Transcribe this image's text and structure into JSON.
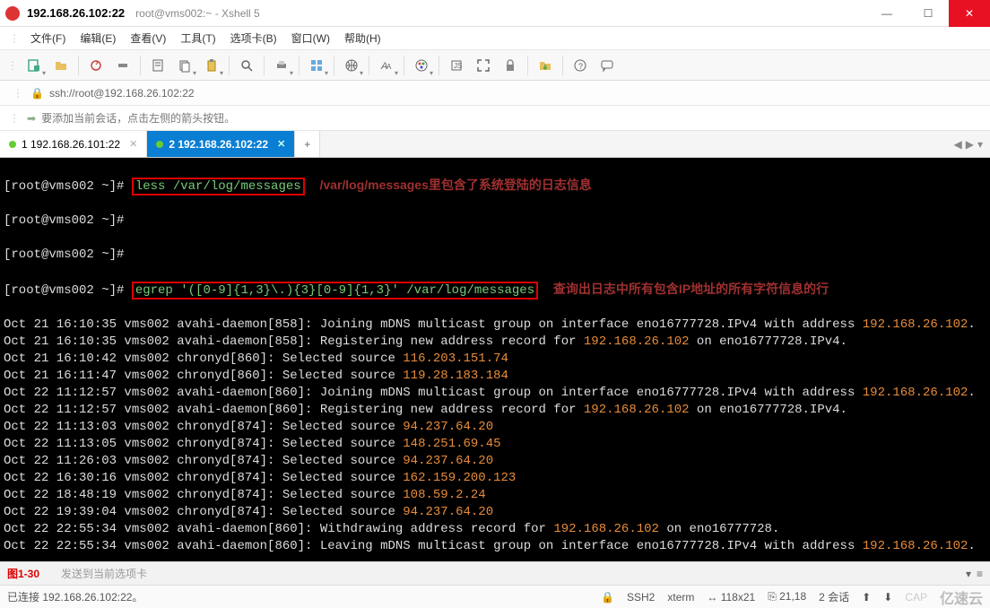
{
  "window": {
    "title_main": "192.168.26.102:22",
    "title_sub": "root@vms002:~ - Xshell 5"
  },
  "menu": {
    "file": "文件(F)",
    "edit": "编辑(E)",
    "view": "查看(V)",
    "tools": "工具(T)",
    "tabs": "选项卡(B)",
    "window": "窗口(W)",
    "help": "帮助(H)"
  },
  "address": {
    "url": "ssh://root@192.168.26.102:22"
  },
  "hint": {
    "text": "要添加当前会话，点击左侧的箭头按钮。"
  },
  "tabs": {
    "items": [
      {
        "label": "1 192.168.26.101:22",
        "active": false
      },
      {
        "label": "2 192.168.26.102:22",
        "active": true
      }
    ]
  },
  "terminal": {
    "prompt": "[root@vms002 ~]#",
    "cmd1": "less /var/log/messages",
    "note1": "/var/log/messages里包含了系统登陆的日志信息",
    "cmd2": "egrep '([0-9]{1,3}\\.){3}[0-9]{1,3}' /var/log/messages",
    "note2": "查询出日志中所有包含IP地址的所有字符信息的行",
    "lines": [
      {
        "pre": "Oct 21 16:10:35 vms002 avahi-daemon[858]: Joining mDNS multicast group on interface eno16777728.IPv4 with address ",
        "ip": "192.168.26.102",
        "post": "."
      },
      {
        "pre": "Oct 21 16:10:35 vms002 avahi-daemon[858]: Registering new address record for ",
        "ip": "192.168.26.102",
        "post": " on eno16777728.IPv4."
      },
      {
        "pre": "Oct 21 16:10:42 vms002 chronyd[860]: Selected source ",
        "ip": "116.203.151.74",
        "post": ""
      },
      {
        "pre": "Oct 21 16:11:47 vms002 chronyd[860]: Selected source ",
        "ip": "119.28.183.184",
        "post": ""
      },
      {
        "pre": "Oct 22 11:12:57 vms002 avahi-daemon[860]: Joining mDNS multicast group on interface eno16777728.IPv4 with address ",
        "ip": "192.168.26.102",
        "post": "."
      },
      {
        "pre": "Oct 22 11:12:57 vms002 avahi-daemon[860]: Registering new address record for ",
        "ip": "192.168.26.102",
        "post": " on eno16777728.IPv4."
      },
      {
        "pre": "Oct 22 11:13:03 vms002 chronyd[874]: Selected source ",
        "ip": "94.237.64.20",
        "post": ""
      },
      {
        "pre": "Oct 22 11:13:05 vms002 chronyd[874]: Selected source ",
        "ip": "148.251.69.45",
        "post": ""
      },
      {
        "pre": "Oct 22 11:26:03 vms002 chronyd[874]: Selected source ",
        "ip": "94.237.64.20",
        "post": ""
      },
      {
        "pre": "Oct 22 16:30:16 vms002 chronyd[874]: Selected source ",
        "ip": "162.159.200.123",
        "post": ""
      },
      {
        "pre": "Oct 22 18:48:19 vms002 chronyd[874]: Selected source ",
        "ip": "108.59.2.24",
        "post": ""
      },
      {
        "pre": "Oct 22 19:39:04 vms002 chronyd[874]: Selected source ",
        "ip": "94.237.64.20",
        "post": ""
      },
      {
        "pre": "Oct 22 22:55:34 vms002 avahi-daemon[860]: Withdrawing address record for ",
        "ip": "192.168.26.102",
        "post": " on eno16777728."
      },
      {
        "pre": "Oct 22 22:55:34 vms002 avahi-daemon[860]: Leaving mDNS multicast group on interface eno16777728.IPv4 with address ",
        "ip": "192.168.26.102",
        "post": "."
      }
    ]
  },
  "bottom": {
    "fig": "图1-30",
    "sendto": "发送到当前选项卡"
  },
  "status": {
    "connected": "已连接 192.168.26.102:22。",
    "ssh": "SSH2",
    "term": "xterm",
    "size": "118x21",
    "cursor": "21,18",
    "sessions": "2 会话",
    "logo": "亿速云"
  },
  "icons": {
    "lock": "🔒",
    "arrow": "➡",
    "plus": "+",
    "min": "—",
    "max": "☐",
    "close": "✕",
    "left": "◀",
    "right": "▶",
    "down": "▾",
    "menu": "≡",
    "up": "⬆",
    "dn": "⬇",
    "cap": "CAP"
  }
}
